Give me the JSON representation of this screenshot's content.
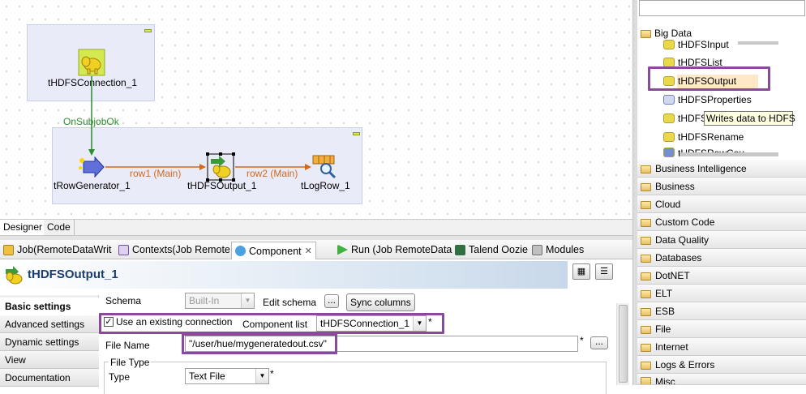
{
  "canvas": {
    "subjob1_component": "tHDFSConnection_1",
    "trigger_label": "OnSubjobOk",
    "components": [
      "tRowGenerator_1",
      "tHDFSOutput_1",
      "tLogRow_1"
    ],
    "links": [
      "row1 (Main)",
      "row2 (Main)"
    ]
  },
  "designer_tabs": [
    "Designer",
    "Code"
  ],
  "view_tabs": [
    {
      "label": "Job(RemoteDataWrit",
      "icon": "job-icon"
    },
    {
      "label": "Contexts(Job Remote",
      "icon": "contexts-icon"
    },
    {
      "label": "Component",
      "icon": "component-icon",
      "close": "✕"
    },
    {
      "label": "Run (Job RemoteData",
      "icon": "run-icon"
    },
    {
      "label": "Talend Oozie",
      "icon": "oozie-icon"
    },
    {
      "label": "Modules",
      "icon": "modules-icon"
    }
  ],
  "component": {
    "title": "tHDFSOutput_1",
    "nav": [
      "Basic settings",
      "Advanced settings",
      "Dynamic settings",
      "View",
      "Documentation"
    ],
    "schema_label": "Schema",
    "schema_value": "Built-In",
    "edit_schema_label": "Edit schema",
    "dots": "...",
    "sync_columns": "Sync columns",
    "use_existing_label": "Use an existing connection",
    "use_existing_checked": true,
    "component_list_label": "Component list",
    "component_list_value": "tHDFSConnection_1",
    "star": "*",
    "file_name_label": "File Name",
    "file_name_value": "\"/user/hue/mygeneratedout.csv\"",
    "file_type_group": "File Type",
    "type_label": "Type",
    "type_value": "Text File"
  },
  "palette": {
    "expanded_category": "Big Data",
    "items": [
      "tHDFSInput",
      "tHDFSList",
      "tHDFSOutput",
      "tHDFSProperties",
      "tHDFS",
      "tHDFSRename",
      "tHDFSRowCou"
    ],
    "tooltip": "Writes data to HDFS",
    "categories": [
      "Business Intelligence",
      "Business",
      "Cloud",
      "Custom Code",
      "Data Quality",
      "Databases",
      "DotNET",
      "ELT",
      "ESB",
      "File",
      "Internet",
      "Logs & Errors",
      "Misc"
    ]
  },
  "colors": {
    "highlight": "#8a4a9a",
    "link": "#d2691e",
    "trigger": "#2e8b2e",
    "title": "#1a3d6e"
  }
}
